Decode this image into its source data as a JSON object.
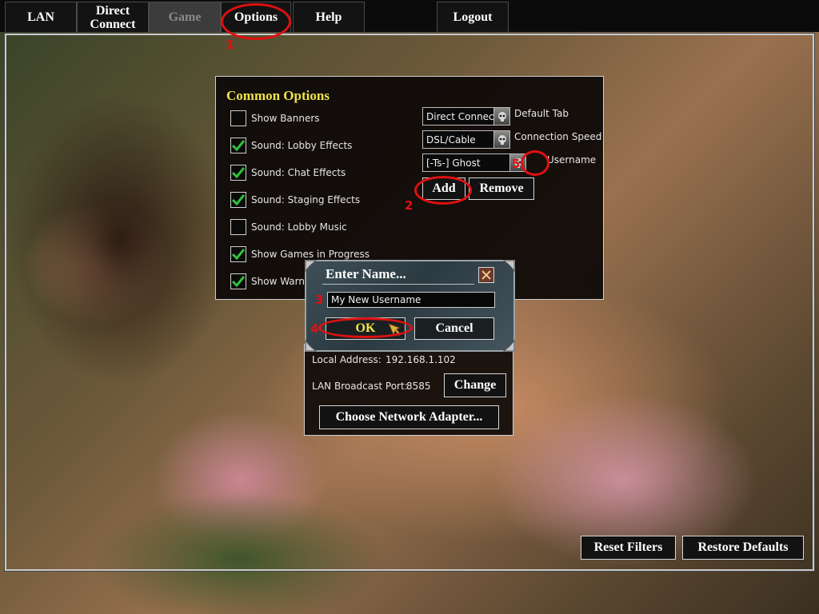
{
  "tabs": [
    {
      "label": "LAN"
    },
    {
      "label": "Direct Connect"
    },
    {
      "label": "Game"
    },
    {
      "label": "Options"
    },
    {
      "label": "Help"
    },
    {
      "label": "Logout"
    }
  ],
  "common_options": {
    "title": "Common Options",
    "checkboxes": [
      {
        "label": "Show Banners",
        "checked": false
      },
      {
        "label": "Sound: Lobby Effects",
        "checked": true
      },
      {
        "label": "Sound: Chat Effects",
        "checked": true
      },
      {
        "label": "Sound: Staging Effects",
        "checked": true
      },
      {
        "label": "Sound: Lobby Music",
        "checked": false
      },
      {
        "label": "Show Games in Progress",
        "checked": true
      },
      {
        "label": "Show Warn",
        "checked": true
      }
    ],
    "default_tab": {
      "value": "Direct Connect",
      "label": "Default Tab"
    },
    "connection_speed": {
      "value": "DSL/Cable",
      "label": "Connection Speed"
    },
    "username": {
      "value": "[-Ts-] Ghost",
      "label": "Username"
    },
    "add_label": "Add",
    "remove_label": "Remove"
  },
  "network": {
    "local_address_label": "Local Address:",
    "local_address": "192.168.1.102",
    "broadcast_port_label": "LAN Broadcast Port:",
    "broadcast_port": "8585",
    "change_label": "Change",
    "choose_adapter_label": "Choose Network Adapter..."
  },
  "dialog": {
    "title": "Enter Name...",
    "input_value": "My New Username",
    "ok_label": "OK",
    "cancel_label": "Cancel"
  },
  "footer": {
    "reset_filters_label": "Reset Filters",
    "restore_defaults_label": "Restore Defaults"
  },
  "annotations": [
    "1",
    "2",
    "3",
    "4",
    "5"
  ],
  "colors": {
    "accent_title": "#f0e44a",
    "annotation": "#e01010",
    "check": "#2fc23a"
  },
  "icons": {
    "combo_button": "skull-icon",
    "dialog_close": "close-icon",
    "cursor": "pointer-hand-icon"
  }
}
